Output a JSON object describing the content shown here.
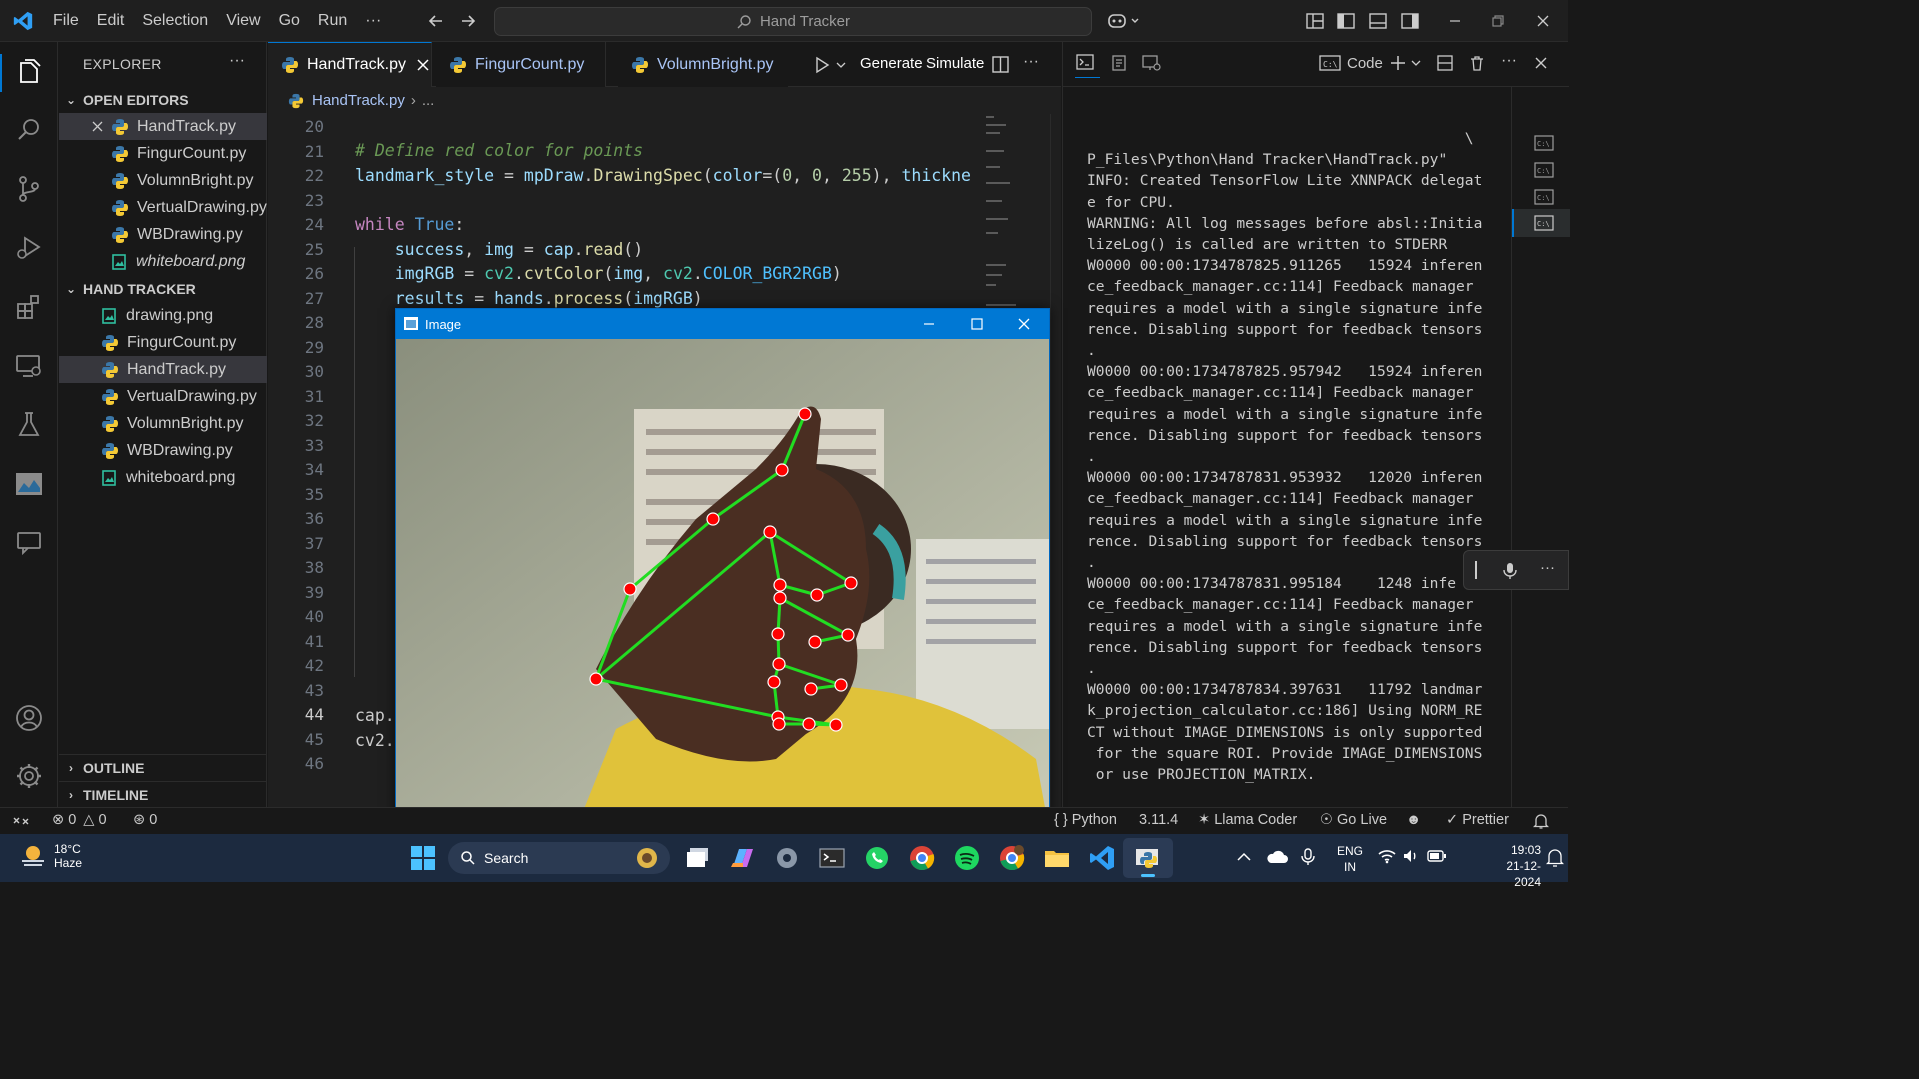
{
  "titlebar": {
    "menu": [
      "File",
      "Edit",
      "Selection",
      "View",
      "Go",
      "Run",
      "···"
    ],
    "search_text": "Hand Tracker"
  },
  "explorer": {
    "header": "EXPLORER",
    "more": "···",
    "open_editors_title": "OPEN EDITORS",
    "open_editors": [
      {
        "name": "HandTrack.py",
        "type": "py"
      },
      {
        "name": "FingurCount.py",
        "type": "py"
      },
      {
        "name": "VolumnBright.py",
        "type": "py"
      },
      {
        "name": "VertualDrawing.py",
        "type": "py"
      },
      {
        "name": "WBDrawing.py",
        "type": "py"
      },
      {
        "name": "whiteboard.png",
        "type": "img"
      }
    ],
    "folder_title": "HAND TRACKER",
    "folder_files": [
      {
        "name": "drawing.png",
        "type": "img"
      },
      {
        "name": "FingurCount.py",
        "type": "py"
      },
      {
        "name": "HandTrack.py",
        "type": "py"
      },
      {
        "name": "VertualDrawing.py",
        "type": "py"
      },
      {
        "name": "VolumnBright.py",
        "type": "py"
      },
      {
        "name": "WBDrawing.py",
        "type": "py"
      },
      {
        "name": "whiteboard.png",
        "type": "img"
      }
    ],
    "outline": "OUTLINE",
    "timeline": "TIMELINE"
  },
  "editor": {
    "tabs": [
      "HandTrack.py",
      "FingurCount.py",
      "VolumnBright.py"
    ],
    "actions": {
      "generate": "Generate",
      "simulate": "Simulate"
    },
    "breadcrumb": {
      "file": "HandTrack.py",
      "rest": "..."
    },
    "line_numbers": [
      "20",
      "21",
      "22",
      "23",
      "24",
      "25",
      "26",
      "27",
      "28",
      "29",
      "30",
      "31",
      "32",
      "33",
      "34",
      "35",
      "36",
      "37",
      "38",
      "39",
      "40",
      "41",
      "42",
      "43",
      "44",
      "45",
      "46"
    ],
    "current_line": "44",
    "code": {
      "l21": "# Define red color for points",
      "l22_a": "landmark_style",
      "l22_b": " = ",
      "l22_c": "mpDraw",
      "l22_d": ".",
      "l22_e": "DrawingSpec",
      "l22_f": "(",
      "l22_g": "color",
      "l22_h": "=(",
      "l22_i": "0",
      "l22_j": ", ",
      "l22_k": "0",
      "l22_l": ", ",
      "l22_m": "255",
      "l22_n": "), ",
      "l22_o": "thickne",
      "l24_a": "while",
      "l24_b": " ",
      "l24_c": "True",
      "l24_d": ":",
      "l25_a": "    success",
      "l25_b": ", ",
      "l25_c": "img",
      "l25_d": " = ",
      "l25_e": "cap",
      "l25_f": ".",
      "l25_g": "read",
      "l25_h": "()",
      "l26_a": "    imgRGB",
      "l26_b": " = ",
      "l26_c": "cv2",
      "l26_d": ".",
      "l26_e": "cvtColor",
      "l26_f": "(",
      "l26_g": "img",
      "l26_h": ", ",
      "l26_i": "cv2",
      "l26_j": ".",
      "l26_k": "COLOR_BGR2RGB",
      "l26_l": ")",
      "l27_a": "    results",
      "l27_b": " = ",
      "l27_c": "hands",
      "l27_d": ".",
      "l27_e": "process",
      "l27_f": "(",
      "l27_g": "imgRGB",
      "l27_h": ")",
      "l44": "cap.",
      "l45": "cv2."
    }
  },
  "panel": {
    "code_label": "Code",
    "terminal_lines": [
      "                                           \\",
      "P_Files\\Python\\Hand Tracker\\HandTrack.py\"",
      "INFO: Created TensorFlow Lite XNNPACK delegat",
      "e for CPU.",
      "WARNING: All log messages before absl::Initia",
      "lizeLog() is called are written to STDERR",
      "W0000 00:00:1734787825.911265   15924 inferen",
      "ce_feedback_manager.cc:114] Feedback manager",
      "requires a model with a single signature infe",
      "rence. Disabling support for feedback tensors",
      ".",
      "W0000 00:00:1734787825.957942   15924 inferen",
      "ce_feedback_manager.cc:114] Feedback manager",
      "requires a model with a single signature infe",
      "rence. Disabling support for feedback tensors",
      ".",
      "W0000 00:00:1734787831.953932   12020 inferen",
      "ce_feedback_manager.cc:114] Feedback manager",
      "requires a model with a single signature infe",
      "rence. Disabling support for feedback tensors",
      ".",
      "W0000 00:00:1734787831.995184    1248 infe",
      "ce_feedback_manager.cc:114] Feedback manager",
      "requires a model with a single signature infe",
      "rence. Disabling support for feedback tensors",
      ".",
      "W0000 00:00:1734787834.397631   11792 landmar",
      "k_projection_calculator.cc:186] Using NORM_RE",
      "CT without IMAGE_DIMENSIONS is only supported",
      " for the square ROI. Provide IMAGE_DIMENSIONS",
      " or use PROJECTION_MATRIX."
    ]
  },
  "cv_window": {
    "title": "Image"
  },
  "statusbar": {
    "errors": "0",
    "warnings": "0",
    "ports": "0",
    "language": "Python",
    "version": "3.11.4",
    "llama": "Llama Coder",
    "golive": "Go Live",
    "prettier": "Prettier"
  },
  "taskbar": {
    "temp": "18°C",
    "weather": "Haze",
    "search": "Search",
    "lang1": "ENG",
    "lang2": "IN",
    "time": "19:03",
    "date": "21-12-2024"
  },
  "colors": {
    "accent": "#0078d4",
    "landmark": "#ff0000",
    "connection": "#22dd22"
  }
}
